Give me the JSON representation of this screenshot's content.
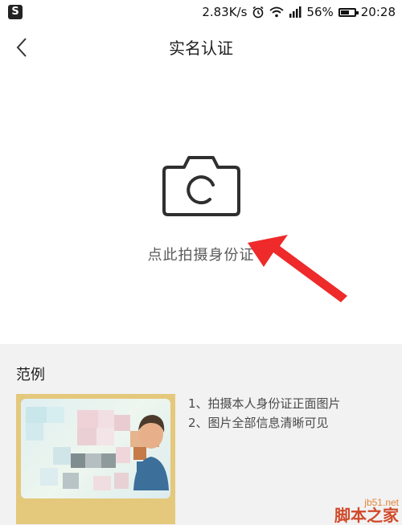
{
  "status_bar": {
    "app_badge": "S",
    "net_speed": "2.83K/s",
    "battery_percent": "56%",
    "battery_level": 0.56,
    "time": "20:28",
    "icons": [
      "alarm-icon",
      "wifi-icon",
      "signal-icon",
      "battery-icon"
    ]
  },
  "nav": {
    "back_icon": "chevron-left-icon",
    "title": "实名认证"
  },
  "capture": {
    "icon": "camera-icon",
    "label": "点此拍摄身份证",
    "arrow_color": "#ee2a2a"
  },
  "example": {
    "heading": "范例",
    "instructions": [
      "1、拍摄本人身份证正面图片",
      "2、图片全部信息清晰可见"
    ]
  },
  "watermark": {
    "url": "jb51.net",
    "name": "脚本之家"
  },
  "colors": {
    "page_bg": "#f2f2f2",
    "card_bg": "#ffffff",
    "title_text": "#1e1e1e",
    "secondary_text": "#5a5a5a"
  }
}
